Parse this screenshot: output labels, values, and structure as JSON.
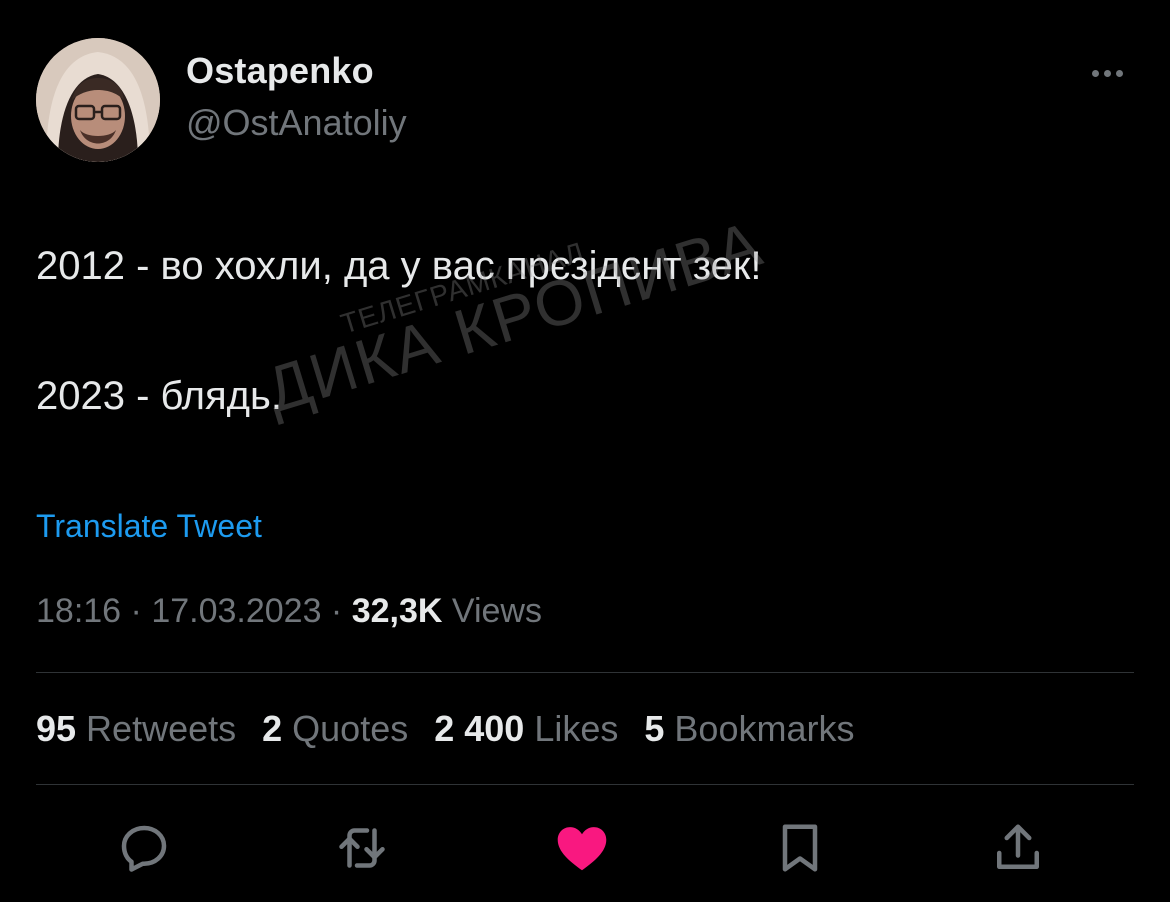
{
  "author": {
    "display_name": "Ostapenko",
    "handle": "@OstAnatoliy"
  },
  "tweet": {
    "lines": [
      "2012 - во хохли, да у вас прєзідєнт зек!",
      "2023 - блядь."
    ],
    "translate_label": "Translate Tweet"
  },
  "watermark": {
    "top": "ТЕЛЕГРАМКАНАЛ",
    "bottom": "ДИКА КРОПИВА"
  },
  "meta": {
    "time": "18:16",
    "separator_1": " · ",
    "date": "17.03.2023",
    "separator_2": " · ",
    "views_count": "32,3K",
    "views_label": " Views"
  },
  "stats": {
    "retweets": {
      "count": "95",
      "label": " Retweets"
    },
    "quotes": {
      "count": "2",
      "label": " Quotes"
    },
    "likes": {
      "count": "2 400",
      "label": " Likes"
    },
    "bookmarks": {
      "count": "5",
      "label": " Bookmarks"
    }
  },
  "actions": [
    {
      "icon": "reply-icon"
    },
    {
      "icon": "retweet-icon"
    },
    {
      "icon": "like-icon-filled"
    },
    {
      "icon": "bookmark-icon"
    },
    {
      "icon": "share-icon"
    }
  ],
  "colors": {
    "background": "#000000",
    "text_primary": "#e7e9ea",
    "text_secondary": "#71767b",
    "link": "#1d9bf0",
    "like": "#f91880",
    "divider": "#2f3336"
  }
}
